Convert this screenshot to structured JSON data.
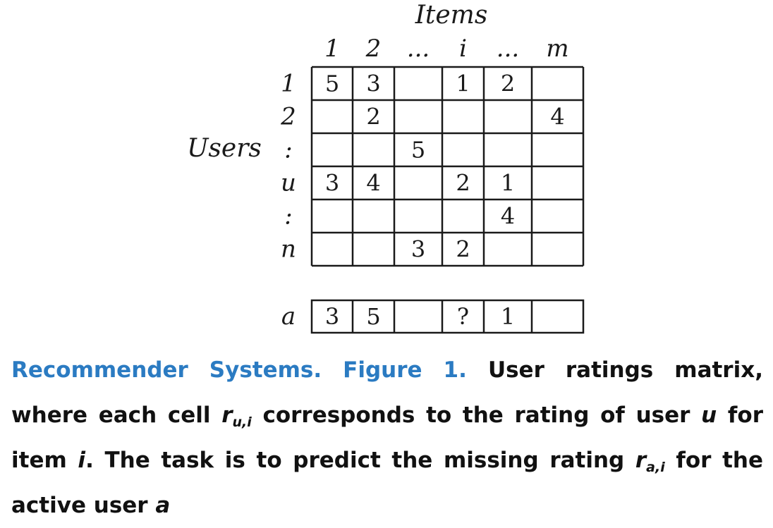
{
  "diagram": {
    "items_label": "Items",
    "users_label": "Users",
    "column_labels": [
      "1",
      "2",
      "...",
      "i",
      "...",
      "m"
    ],
    "row_labels": [
      "1",
      "2",
      ":",
      "u",
      ":",
      "n"
    ],
    "matrix": [
      [
        "5",
        "3",
        "",
        "1",
        "2",
        ""
      ],
      [
        "",
        "2",
        "",
        "",
        "",
        "4"
      ],
      [
        "",
        "",
        "5",
        "",
        "",
        ""
      ],
      [
        "3",
        "4",
        "",
        "2",
        "1",
        ""
      ],
      [
        "",
        "",
        "",
        "",
        "4",
        ""
      ],
      [
        "",
        "",
        "3",
        "2",
        "",
        ""
      ]
    ],
    "active_row_label": "a",
    "active_row": [
      "3",
      "5",
      "",
      "?",
      "1",
      ""
    ]
  },
  "caption": {
    "title": "Recommender Systems. Figure 1.",
    "text_1": "User ratings matrix, where each cell",
    "r_symbol": "r",
    "sub_ui": "u,i",
    "text_2": "corresponds to the rating of user",
    "u_symbol": "u",
    "text_3": "for item",
    "i_symbol": "i",
    "text_4": ". The task is to predict the missing rating",
    "sub_ai": "a,i",
    "text_5": "for the active user",
    "a_symbol": "a"
  }
}
